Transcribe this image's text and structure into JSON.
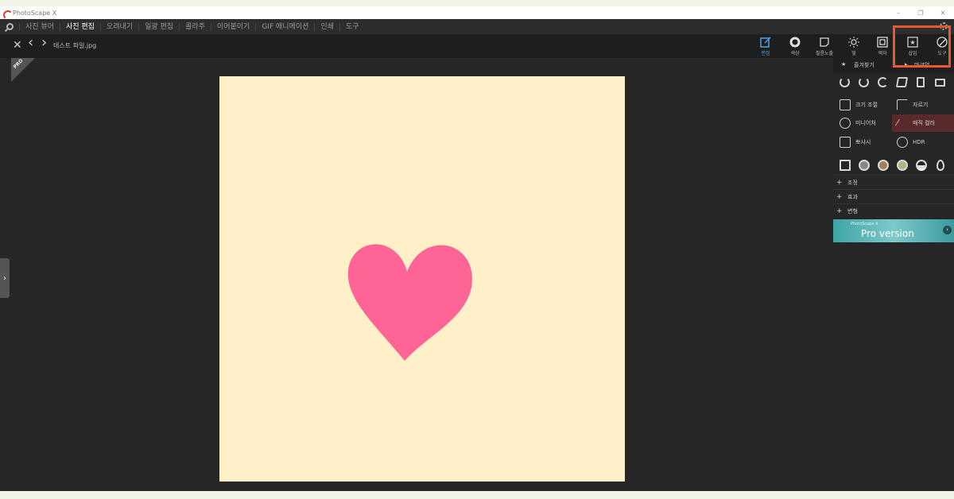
{
  "titlebar": {
    "app_title": "PhotoScape X",
    "minimize": "–",
    "restore": "❐",
    "close": "✕"
  },
  "menu": {
    "items": [
      "사진 뷰어",
      "사진 편집",
      "오려내기",
      "일괄 편집",
      "콜라주",
      "이어붙이기",
      "GIF 애니메이션",
      "인쇄",
      "도구"
    ],
    "active": "사진 편집"
  },
  "toolbar": {
    "file_name": "테스트 파일.jpg",
    "close_icon": "✕",
    "prev_icon": "‹",
    "next_icon": "›",
    "tools": [
      "편집",
      "색상",
      "필름노출",
      "빛",
      "액자",
      "삽입",
      "도구"
    ]
  },
  "workspace": {
    "pro_badge": "PRO",
    "expand_icon": "›",
    "canvas_color": "#fff0c8",
    "heart_color": "#ff6496"
  },
  "panel": {
    "favorites": "즐겨찾기",
    "tab2": "마크업",
    "buttons": {
      "resize": "크기 조절",
      "crop": "자르기",
      "miniature": "미니어처",
      "magic_color": "매직 컬러",
      "bloom": "뽀샤시",
      "hdr": "HDR"
    },
    "sections": [
      "조정",
      "효과",
      "변형"
    ],
    "pro_banner": {
      "sub": "PhotoScape X",
      "main": "Pro version",
      "arrow": "›"
    }
  },
  "accent": {
    "highlight": "#e8582d",
    "active_tool": "#4aa0e8"
  }
}
